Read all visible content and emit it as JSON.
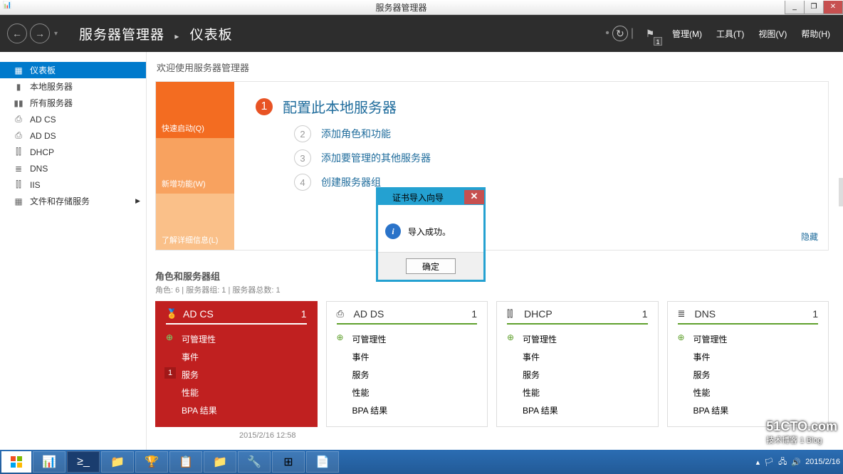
{
  "window": {
    "title": "服务器管理器",
    "controls": {
      "min": "_",
      "max": "❐",
      "close": "✕"
    }
  },
  "header": {
    "breadcrumb1": "服务器管理器",
    "breadcrumb2": "仪表板",
    "flag_badge": "1",
    "menus": {
      "manage": "管理(M)",
      "tools": "工具(T)",
      "view": "视图(V)",
      "help": "帮助(H)"
    }
  },
  "sidebar": {
    "items": [
      {
        "icon": "▦",
        "label": "仪表板"
      },
      {
        "icon": "▮",
        "label": "本地服务器"
      },
      {
        "icon": "▮▮",
        "label": "所有服务器"
      },
      {
        "icon": "⎙",
        "label": "AD CS"
      },
      {
        "icon": "⎙",
        "label": "AD DS"
      },
      {
        "icon": "⫿⫿",
        "label": "DHCP"
      },
      {
        "icon": "≣",
        "label": "DNS"
      },
      {
        "icon": "⫿⫿",
        "label": "IIS"
      },
      {
        "icon": "▦",
        "label": "文件和存储服务",
        "arrow": "▶"
      }
    ]
  },
  "welcome": {
    "title": "欢迎使用服务器管理器",
    "tabs": {
      "quick": "快速启动(Q)",
      "new": "新增功能(W)",
      "learn": "了解详细信息(L)"
    },
    "steps": {
      "s1": "配置此本地服务器",
      "s2": "添加角色和功能",
      "s3": "添加要管理的其他服务器",
      "s4": "创建服务器组"
    },
    "hide": "隐藏"
  },
  "roles": {
    "header": "角色和服务器组",
    "sub": "角色: 6 | 服务器组: 1 | 服务器总数: 1",
    "timestamp": "2015/2/16 12:58",
    "cards": [
      {
        "name": "AD CS",
        "count": "1"
      },
      {
        "name": "AD DS",
        "count": "1"
      },
      {
        "name": "DHCP",
        "count": "1"
      },
      {
        "name": "DNS",
        "count": "1"
      }
    ],
    "items": {
      "i1": "可管理性",
      "i2": "事件",
      "i3": "服务",
      "i4": "性能",
      "i5": "BPA 结果"
    }
  },
  "dialog": {
    "title": "证书导入向导",
    "message": "导入成功。",
    "ok": "确定"
  },
  "taskbar": {
    "date": "2015/2/16"
  },
  "watermark": {
    "line1": "51CTO.com",
    "line2": "技术博客 1 Blog"
  }
}
